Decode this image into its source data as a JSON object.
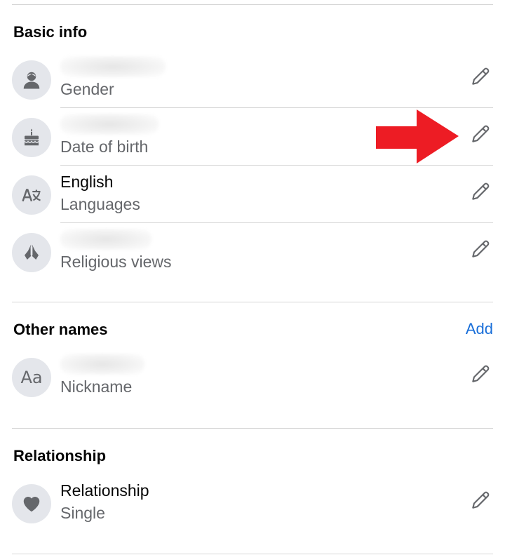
{
  "sections": {
    "basic_info": {
      "title": "Basic info",
      "rows": [
        {
          "value": "",
          "label": "Gender",
          "icon": "person-icon"
        },
        {
          "value": "",
          "label": "Date of birth",
          "icon": "birthday-cake-icon"
        },
        {
          "value": "English",
          "label": "Languages",
          "icon": "translate-icon"
        },
        {
          "value": "",
          "label": "Religious views",
          "icon": "praying-hands-icon"
        }
      ]
    },
    "other_names": {
      "title": "Other names",
      "add_label": "Add",
      "rows": [
        {
          "value": "",
          "label": "Nickname",
          "icon": "text-aa-icon"
        }
      ]
    },
    "relationship": {
      "title": "Relationship",
      "rows": [
        {
          "value": "Relationship",
          "label": "Single",
          "icon": "heart-icon"
        }
      ]
    }
  },
  "annotation": {
    "icon": "red-arrow-icon",
    "color": "#ed1c24"
  },
  "colors": {
    "text": "#050505",
    "secondary": "#65676b",
    "link": "#1a6fd9",
    "icon_bg": "#e4e6eb",
    "icon_fg": "#65676b"
  }
}
